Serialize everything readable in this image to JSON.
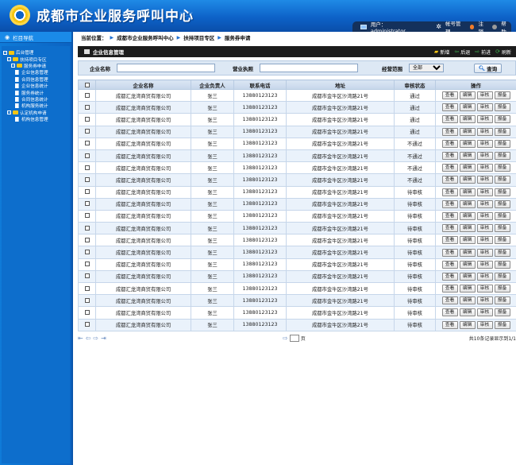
{
  "header": {
    "title": "成都市企业服务呼叫中心",
    "user_label": "用户：administrator",
    "account_label": "帐号管理",
    "logout_label": "注销",
    "help_label": "帮助"
  },
  "sidebar": {
    "title": "栏目导航",
    "items": [
      {
        "label": "后台管理",
        "level": 0,
        "type": "folder"
      },
      {
        "label": "扶持项目专区",
        "level": 1,
        "type": "folder"
      },
      {
        "label": "服务券申请",
        "level": 2,
        "type": "folder"
      },
      {
        "label": "企业信息管理",
        "level": 3,
        "type": "file"
      },
      {
        "label": "合同信息管理",
        "level": 3,
        "type": "file"
      },
      {
        "label": "企业信息统计",
        "level": 3,
        "type": "file"
      },
      {
        "label": "服务券统计",
        "level": 3,
        "type": "file"
      },
      {
        "label": "合同信息统计",
        "level": 3,
        "type": "file"
      },
      {
        "label": "机构服务统计",
        "level": 3,
        "type": "file"
      },
      {
        "label": "认定机构申请",
        "level": 1,
        "type": "folder"
      },
      {
        "label": "机构信息管理",
        "level": 3,
        "type": "file"
      }
    ]
  },
  "breadcrumb": {
    "prefix": "当前位置：",
    "items": [
      "成都市企业服务呼叫中心",
      "扶持项目专区",
      "服务券申请"
    ]
  },
  "panel": {
    "title": "企业信息管理",
    "toolbar": [
      "新增",
      "后退",
      "前进",
      "刷新"
    ]
  },
  "filter": {
    "name_label": "企业名称",
    "license_label": "营业执照",
    "scope_label": "经营范围",
    "scope_selected": "全部",
    "query_label": "查询"
  },
  "table": {
    "columns": [
      "",
      "企业名称",
      "企业负责人",
      "联系电话",
      "地址",
      "审核状态",
      "操作"
    ],
    "actions": [
      "查看",
      "编辑",
      "审核",
      "报备"
    ],
    "rows": [
      {
        "name": "成都汇龙湾商贸有限公司",
        "person": "张三",
        "phone": "13880123123",
        "address": "成都市金牛区沙湾路21号",
        "status": "通过"
      },
      {
        "name": "成都汇龙湾商贸有限公司",
        "person": "张三",
        "phone": "13880123123",
        "address": "成都市金牛区沙湾路21号",
        "status": "通过"
      },
      {
        "name": "成都汇龙湾商贸有限公司",
        "person": "张三",
        "phone": "13880123123",
        "address": "成都市金牛区沙湾路21号",
        "status": "通过"
      },
      {
        "name": "成都汇龙湾商贸有限公司",
        "person": "张三",
        "phone": "13880123123",
        "address": "成都市金牛区沙湾路21号",
        "status": "通过"
      },
      {
        "name": "成都汇龙湾商贸有限公司",
        "person": "张三",
        "phone": "13880123123",
        "address": "成都市金牛区沙湾路21号",
        "status": "不通过"
      },
      {
        "name": "成都汇龙湾商贸有限公司",
        "person": "张三",
        "phone": "13880123123",
        "address": "成都市金牛区沙湾路21号",
        "status": "不通过"
      },
      {
        "name": "成都汇龙湾商贸有限公司",
        "person": "张三",
        "phone": "13880123123",
        "address": "成都市金牛区沙湾路21号",
        "status": "不通过"
      },
      {
        "name": "成都汇龙湾商贸有限公司",
        "person": "张三",
        "phone": "13880123123",
        "address": "成都市金牛区沙湾路21号",
        "status": "不通过"
      },
      {
        "name": "成都汇龙湾商贸有限公司",
        "person": "张三",
        "phone": "13880123123",
        "address": "成都市金牛区沙湾路21号",
        "status": "待审核"
      },
      {
        "name": "成都汇龙湾商贸有限公司",
        "person": "张三",
        "phone": "13880123123",
        "address": "成都市金牛区沙湾路21号",
        "status": "待审核"
      },
      {
        "name": "成都汇龙湾商贸有限公司",
        "person": "张三",
        "phone": "13880123123",
        "address": "成都市金牛区沙湾路21号",
        "status": "待审核"
      },
      {
        "name": "成都汇龙湾商贸有限公司",
        "person": "张三",
        "phone": "13880123123",
        "address": "成都市金牛区沙湾路21号",
        "status": "待审核"
      },
      {
        "name": "成都汇龙湾商贸有限公司",
        "person": "张三",
        "phone": "13880123123",
        "address": "成都市金牛区沙湾路21号",
        "status": "待审核"
      },
      {
        "name": "成都汇龙湾商贸有限公司",
        "person": "张三",
        "phone": "13880123123",
        "address": "成都市金牛区沙湾路21号",
        "status": "待审核"
      },
      {
        "name": "成都汇龙湾商贸有限公司",
        "person": "张三",
        "phone": "13880123123",
        "address": "成都市金牛区沙湾路21号",
        "status": "待审核"
      },
      {
        "name": "成都汇龙湾商贸有限公司",
        "person": "张三",
        "phone": "13880123123",
        "address": "成都市金牛区沙湾路21号",
        "status": "待审核"
      },
      {
        "name": "成都汇龙湾商贸有限公司",
        "person": "张三",
        "phone": "13880123123",
        "address": "成都市金牛区沙湾路21号",
        "status": "待审核"
      },
      {
        "name": "成都汇龙湾商贸有限公司",
        "person": "张三",
        "phone": "13880123123",
        "address": "成都市金牛区沙湾路21号",
        "status": "待审核"
      },
      {
        "name": "成都汇龙湾商贸有限公司",
        "person": "张三",
        "phone": "13880123123",
        "address": "成都市金牛区沙湾路21号",
        "status": "待审核"
      },
      {
        "name": "成都汇龙湾商贸有限公司",
        "person": "张三",
        "phone": "13880123123",
        "address": "成都市金牛区沙湾路21号",
        "status": "待审核"
      }
    ]
  },
  "pager": {
    "page_unit": "页",
    "summary": "共10条记录显示到1/1"
  },
  "colors": {
    "header_blue": "#0d62c8",
    "sidebar_blue": "#0d6ecc",
    "row_alt": "#eaf2fb",
    "toolbar_dark": "#1c1c1c"
  }
}
